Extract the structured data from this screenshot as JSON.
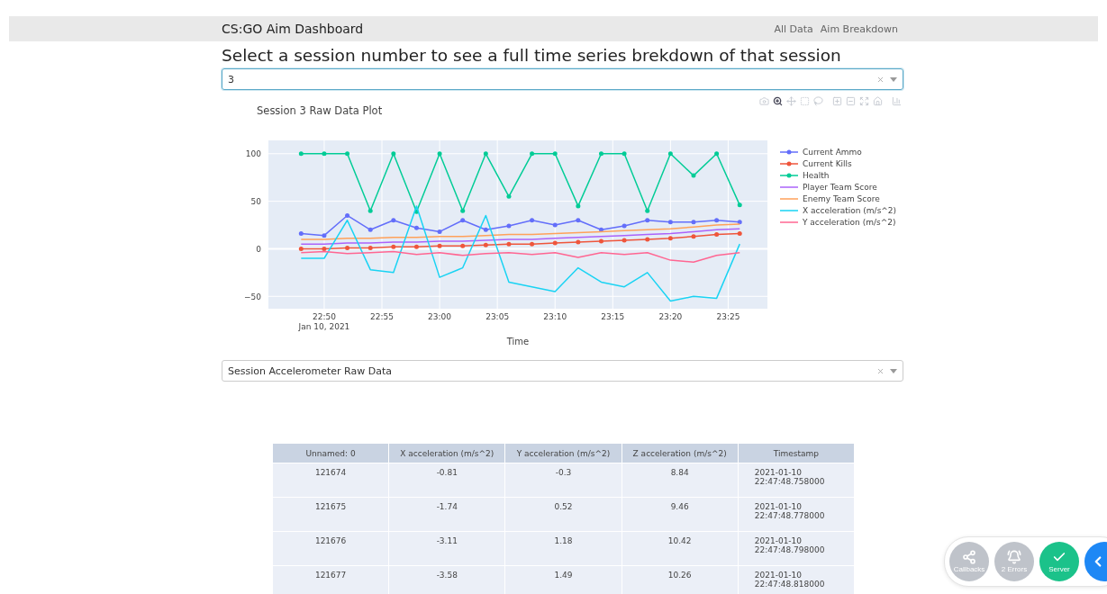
{
  "navbar": {
    "title": "CS:GO Aim Dashboard",
    "links": [
      "All Data",
      "Aim Breakdown"
    ]
  },
  "heading": "Select a session number to see a full time series brekdown of that session",
  "session_select": {
    "value": "3"
  },
  "modebar": [
    {
      "kind": "camera",
      "selected": false
    },
    {
      "kind": "zoom",
      "selected": true
    },
    {
      "kind": "pan",
      "selected": false
    },
    {
      "kind": "box",
      "selected": false
    },
    {
      "kind": "lasso",
      "selected": false
    },
    {
      "kind": "zoom-in",
      "selected": false
    },
    {
      "kind": "zoom-out",
      "selected": false
    },
    {
      "kind": "autoscale",
      "selected": false
    },
    {
      "kind": "home",
      "selected": false
    },
    {
      "kind": "logo",
      "selected": false
    }
  ],
  "chart_data": {
    "type": "line",
    "title": "Session 3 Raw Data Plot",
    "xlabel": "Time",
    "x": [
      "2021-01-10T22:48:00",
      "2021-01-10T22:50:00",
      "2021-01-10T22:52:00",
      "2021-01-10T22:54:00",
      "2021-01-10T22:56:00",
      "2021-01-10T22:58:00",
      "2021-01-10T23:00:00",
      "2021-01-10T23:02:00",
      "2021-01-10T23:04:00",
      "2021-01-10T23:06:00",
      "2021-01-10T23:08:00",
      "2021-01-10T23:10:00",
      "2021-01-10T23:12:00",
      "2021-01-10T23:14:00",
      "2021-01-10T23:16:00",
      "2021-01-10T23:18:00",
      "2021-01-10T23:20:00",
      "2021-01-10T23:22:00",
      "2021-01-10T23:24:00",
      "2021-01-10T23:26:00"
    ],
    "xlim": [
      "2021-01-10T22:45:10",
      "2021-01-10T23:28:24"
    ],
    "ylim": [
      -63,
      114
    ],
    "xticks": [
      {
        "value": "2021-01-10T22:50:00",
        "label": "22:50\nJan 10, 2021"
      },
      {
        "value": "2021-01-10T22:55:00",
        "label": "22:55"
      },
      {
        "value": "2021-01-10T23:00:00",
        "label": "23:00"
      },
      {
        "value": "2021-01-10T23:05:00",
        "label": "23:05"
      },
      {
        "value": "2021-01-10T23:10:00",
        "label": "23:10"
      },
      {
        "value": "2021-01-10T23:15:00",
        "label": "23:15"
      },
      {
        "value": "2021-01-10T23:20:00",
        "label": "23:20"
      },
      {
        "value": "2021-01-10T23:25:00",
        "label": "23:25"
      }
    ],
    "yticks": [
      -50,
      0,
      50,
      100
    ],
    "grid": true,
    "legend": true,
    "series": [
      {
        "name": "Current Ammo",
        "color": "#636efa",
        "values": [
          16,
          14,
          35,
          20,
          30,
          22,
          18,
          30,
          20,
          24,
          30,
          25,
          30,
          20,
          24,
          30,
          28,
          28,
          30,
          28
        ]
      },
      {
        "name": "Current Kills",
        "color": "#ef553b",
        "values": [
          0,
          0,
          1,
          1,
          2,
          2,
          3,
          3,
          4,
          5,
          5,
          6,
          7,
          8,
          9,
          10,
          11,
          13,
          15,
          16
        ]
      },
      {
        "name": "Health",
        "color": "#00cc96",
        "values": [
          100,
          100,
          100,
          40,
          100,
          39,
          100,
          40,
          100,
          55,
          100,
          100,
          45,
          100,
          100,
          40,
          100,
          77,
          100,
          46
        ]
      },
      {
        "name": "Player Team Score",
        "color": "#ab63fa",
        "values": [
          5,
          5,
          6,
          6,
          7,
          7,
          8,
          8,
          9,
          10,
          10,
          11,
          12,
          13,
          14,
          15,
          16,
          18,
          20,
          21
        ]
      },
      {
        "name": "Enemy Team Score",
        "color": "#ffa15a",
        "values": [
          10,
          10,
          11,
          11,
          12,
          12,
          13,
          13,
          14,
          15,
          15,
          16,
          17,
          18,
          19,
          20,
          21,
          23,
          25,
          26
        ]
      },
      {
        "name": "X acceleration (m/s^2)",
        "color": "#19d3f3",
        "values": [
          -10,
          -10,
          30,
          -22,
          -25,
          45,
          -30,
          -20,
          35,
          -35,
          -40,
          -45,
          -20,
          -35,
          -40,
          -25,
          -55,
          -50,
          -52,
          5
        ]
      },
      {
        "name": "Y acceleration (m/s^2)",
        "color": "#ff6692",
        "values": [
          -4,
          -3,
          -5,
          -4,
          -3,
          -6,
          -4,
          -7,
          -5,
          -4,
          -6,
          -4,
          -9,
          -4,
          -6,
          -4,
          -12,
          -14,
          -7,
          -4
        ]
      }
    ]
  },
  "trace_markers": [
    true,
    true,
    true,
    false,
    false,
    false,
    false
  ],
  "data_select": {
    "value": "Session Accelerometer Raw Data"
  },
  "table": {
    "columns": [
      "Unnamed: 0",
      "X acceleration (m/s^2)",
      "Y acceleration (m/s^2)",
      "Z acceleration (m/s^2)",
      "Timestamp"
    ],
    "rows": [
      [
        "121674",
        "-0.81",
        "-0.3",
        "8.84",
        "2021-01-10 22:47:48.758000"
      ],
      [
        "121675",
        "-1.74",
        "0.52",
        "9.46",
        "2021-01-10 22:47:48.778000"
      ],
      [
        "121676",
        "-3.11",
        "1.18",
        "10.42",
        "2021-01-10 22:47:48.798000"
      ],
      [
        "121677",
        "-3.58",
        "1.49",
        "10.26",
        "2021-01-10 22:47:48.818000"
      ]
    ]
  },
  "debug_menu": [
    {
      "kind": "callbacks",
      "label": "Callbacks"
    },
    {
      "kind": "errors",
      "label": "2 Errors"
    },
    {
      "kind": "server",
      "label": "Server"
    }
  ]
}
